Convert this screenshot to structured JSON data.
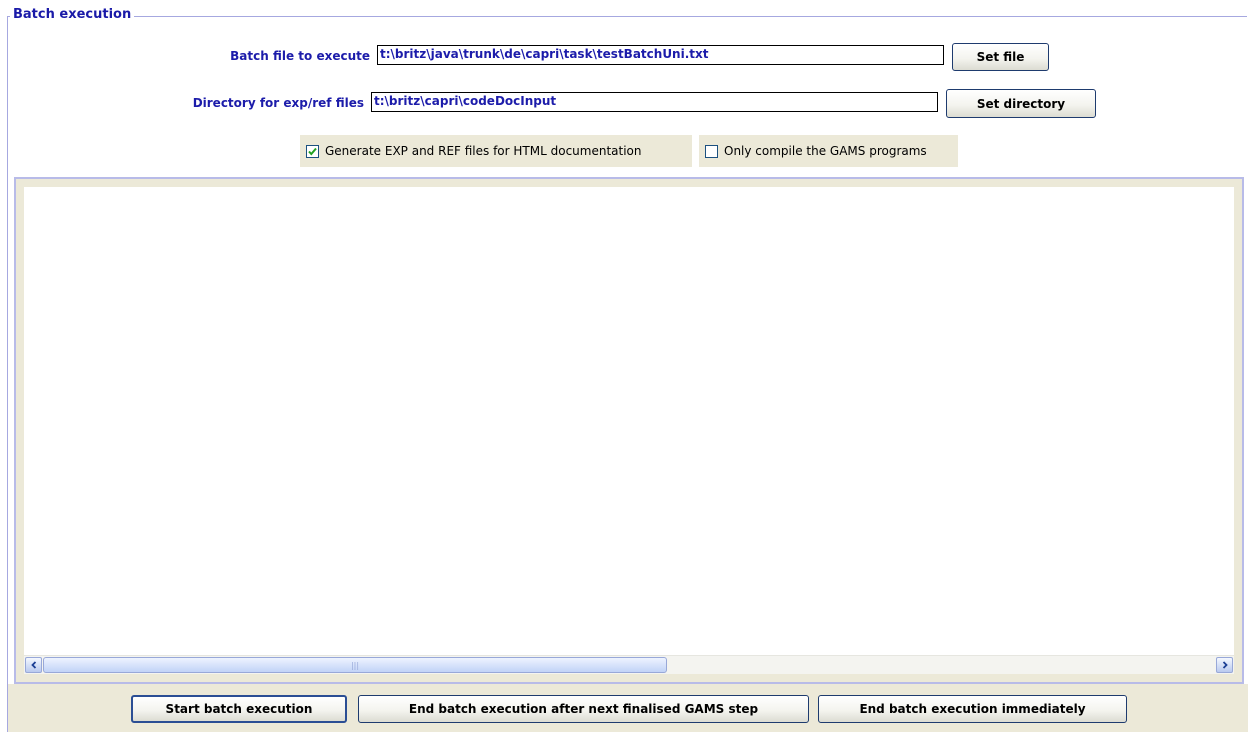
{
  "panel": {
    "title": "Batch execution"
  },
  "batch_file": {
    "label": "Batch file to execute",
    "value": "t:\\britz\\java\\trunk\\de\\capri\\task\\testBatchUni.txt",
    "button": "Set file"
  },
  "directory": {
    "label": "Directory for exp/ref files",
    "value": "t:\\britz\\capri\\codeDocInput",
    "button": "Set directory"
  },
  "options": {
    "generate_exp_ref": {
      "label": "Generate EXP and REF files for HTML documentation",
      "checked": true
    },
    "only_compile": {
      "label": "Only compile the GAMS programs",
      "checked": false
    }
  },
  "output": {
    "text": ""
  },
  "actions": {
    "start": "Start batch execution",
    "end_after_step": "End batch execution after next finalised GAMS step",
    "end_immediately": "End batch execution immediately"
  },
  "colors": {
    "label_blue": "#1c1caa",
    "panel_bg": "#ece9d8",
    "border": "#a6a8e0",
    "check_green": "#21a121"
  }
}
